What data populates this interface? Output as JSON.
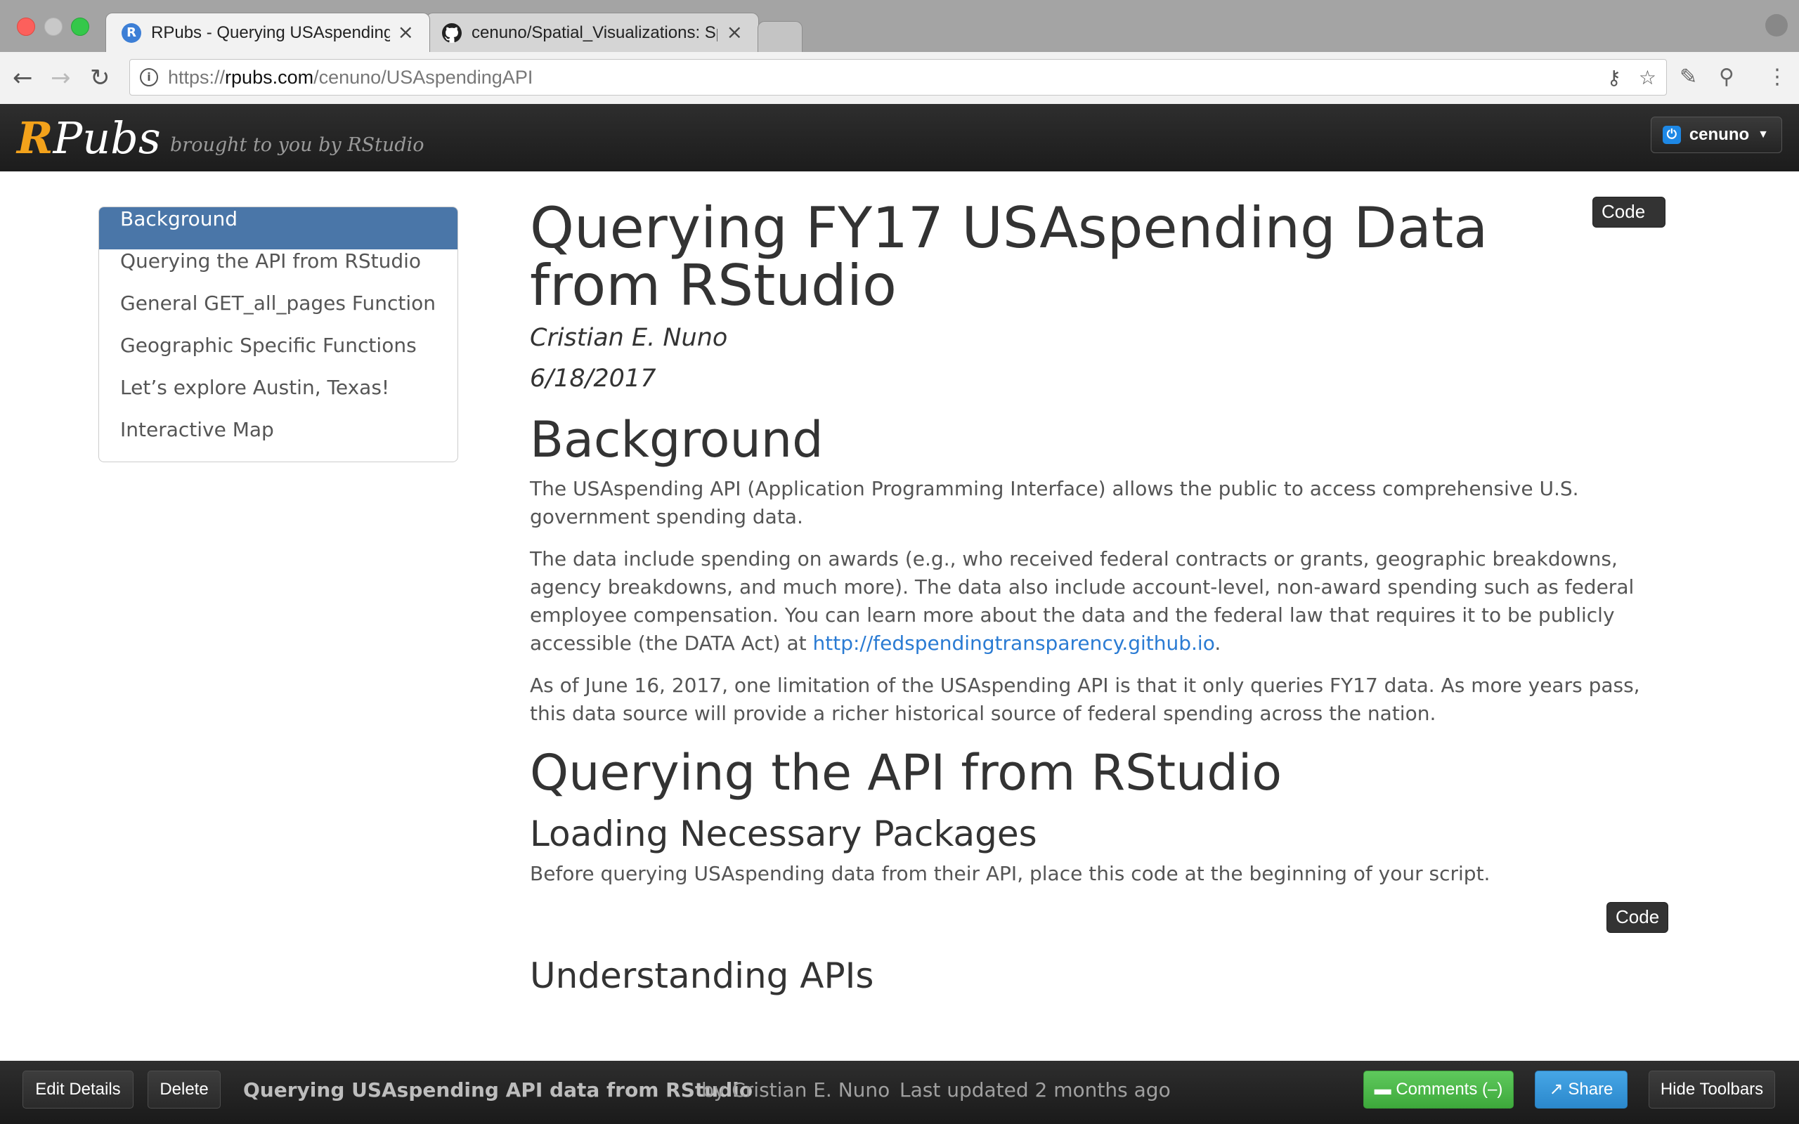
{
  "browser": {
    "tabs": [
      {
        "title": "RPubs - Querying USAspending API data from RStudio",
        "active": true,
        "favicon": "rpubs-icon"
      },
      {
        "title": "cenuno/Spatial_Visualizations: Spatial Visualizations",
        "active": false,
        "favicon": "github-icon"
      }
    ],
    "url_scheme": "https://",
    "url_host": "rpubs.com",
    "url_path": "/cenuno/USAspendingAPI"
  },
  "rpubs": {
    "logo_r": "R",
    "logo_rest": "Pubs",
    "tagline": "brought to you by RStudio",
    "user": "cenuno"
  },
  "toc": {
    "items": [
      {
        "label": "Background",
        "active": true
      },
      {
        "label": "Querying the API from RStudio"
      },
      {
        "label": "General GET_all_pages Function"
      },
      {
        "label": "Geographic Specific Functions"
      },
      {
        "label": "Let’s explore Austin, Texas!"
      },
      {
        "label": "Interactive Map"
      }
    ]
  },
  "doc": {
    "code_toggle": "Code",
    "title": "Querying FY17 USAspending Data from RStudio",
    "author": "Cristian E. Nuno",
    "date": "6/18/2017",
    "background": {
      "heading": "Background",
      "p1": "The USAspending API (Application Programming Interface) allows the public to access comprehensive U.S. government spending data.",
      "p2_text": "The data include spending on awards (e.g., who received federal contracts or grants, geographic breakdowns, agency breakdowns, and much more). The data also include account-level, non-award spending such as federal employee compensation. You can learn more about the data and the federal law that requires it to be publicly accessible (the DATA Act) at ",
      "p2_link": "http://fedspendingtransparency.github.io",
      "p2_end": ".",
      "p3": "As of June 16, 2017, one limitation of the USAspending API is that it only queries FY17 data. As more years pass, this data source will provide a richer historical source of federal spending across the nation."
    },
    "querying": {
      "heading": "Querying the API from RStudio",
      "sub1": "Loading Necessary Packages",
      "sub1_p": "Before querying USAspending data from their API, place this code at the beginning of your script.",
      "code_btn": "Code",
      "sub2": "Understanding APIs"
    }
  },
  "bottom": {
    "edit": "Edit Details",
    "delete": "Delete",
    "doc_title": "Querying USAspending API data from RStudio",
    "by": "by Cristian E. Nuno",
    "updated": "Last updated 2 months ago",
    "comments": "Comments (–)",
    "share": "Share",
    "hide": "Hide Toolbars"
  },
  "colors": {
    "accent_blue": "#4a76a8",
    "logo_orange": "#f3a21b",
    "link": "#2a7bd3",
    "comments_green": "#4cb84a",
    "share_blue": "#3597db"
  }
}
